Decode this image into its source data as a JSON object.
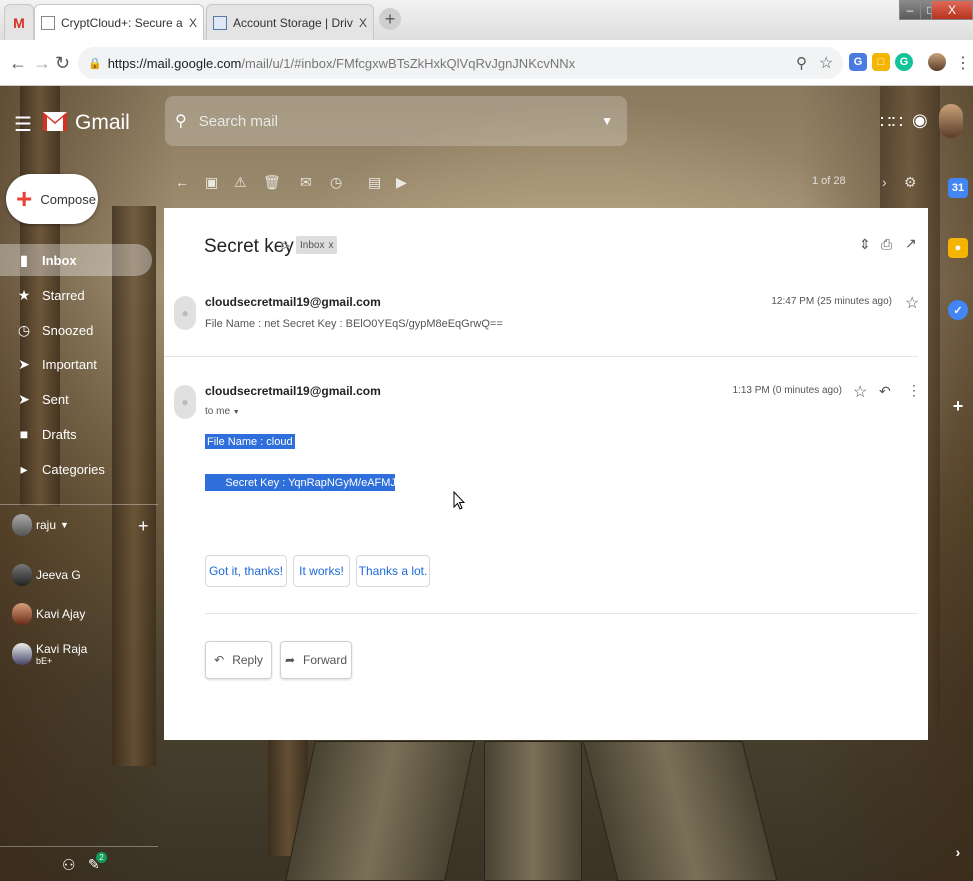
{
  "browser": {
    "tabs": [
      {
        "title": "CryptCloud+: Secure and Expres",
        "icon": "doc-favicon",
        "close": "X"
      },
      {
        "title": "Account Storage | DriveHQ",
        "icon": "drivehq-favicon",
        "close": "X"
      }
    ],
    "gmail_tab_icon": "M",
    "new_tab": "+",
    "window": {
      "minimize": "–",
      "restore": "□",
      "close": "X"
    },
    "url_host": "https://mail.google.com",
    "url_path": "/mail/u/1/#inbox/FMfcgxwBTsZkHxkQlVqRvJgnJNKcvNNx"
  },
  "gmail": {
    "logo_text": "Gmail",
    "search_placeholder": "Search mail",
    "compose_label": "Compose",
    "nav": [
      {
        "label": "Inbox",
        "icon": "inbox-icon"
      },
      {
        "label": "Starred",
        "icon": "star-icon"
      },
      {
        "label": "Snoozed",
        "icon": "clock-icon"
      },
      {
        "label": "Important",
        "icon": "important-icon"
      },
      {
        "label": "Sent",
        "icon": "send-icon"
      },
      {
        "label": "Drafts",
        "icon": "draft-icon"
      },
      {
        "label": "Categories",
        "icon": "label-icon"
      }
    ],
    "hangouts_user": "raju",
    "contacts": [
      {
        "name": "Jeeva G",
        "sub": ""
      },
      {
        "name": "Kavi Ajay",
        "sub": ""
      },
      {
        "name": "Kavi Raja",
        "sub": "bE+"
      }
    ],
    "pager": "1 of 28",
    "hangouts_badge": "2"
  },
  "email": {
    "subject": "Secret key",
    "label_chip": "Inbox",
    "label_close": "x",
    "messages": [
      {
        "sender": "cloudsecretmail19@gmail.com",
        "snippet": "File Name : net Secret Key : BElO0YEqS/gypM8eEqGrwQ==",
        "time": "12:47 PM (25 minutes ago)"
      },
      {
        "sender": "cloudsecretmail19@gmail.com",
        "to": "to me",
        "time": "1:13 PM (0 minutes ago)",
        "body_line1": "File Name : cloud",
        "body_line2": "      Secret Key : YqnRapNGyM/eAFMJE+AczQ=="
      }
    ],
    "smart_replies": [
      "Got it, thanks!",
      "It works!",
      "Thanks a lot."
    ],
    "reply_label": "Reply",
    "forward_label": "Forward"
  }
}
